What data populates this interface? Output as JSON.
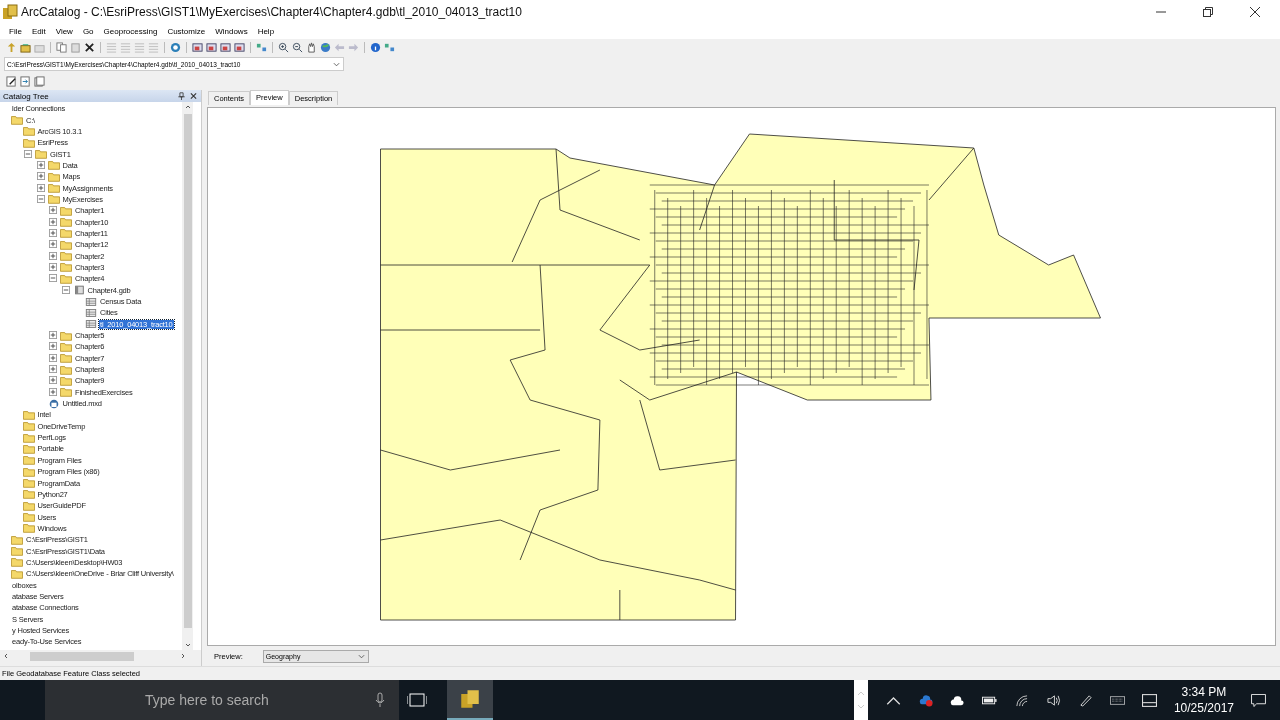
{
  "window": {
    "title": "ArcCatalog - C:\\EsriPress\\GIST1\\MyExercises\\Chapter4\\Chapter4.gdb\\tl_2010_04013_tract10"
  },
  "menu": [
    "File",
    "Edit",
    "View",
    "Go",
    "Geoprocessing",
    "Customize",
    "Windows",
    "Help"
  ],
  "location": {
    "value": "C:\\EsriPress\\GIST1\\MyExercises\\Chapter4\\Chapter4.gdb\\tl_2010_04013_tract10"
  },
  "catalog_tree": {
    "title": "Catalog Tree",
    "items": [
      {
        "label": "lder Connections",
        "selected": false,
        "children": [
          {
            "label": "C:\\",
            "kind": "folder",
            "selected": false,
            "children": [
              {
                "label": "ArcGIS 10.3.1",
                "kind": "folder",
                "selected": false
              },
              {
                "label": "EsriPress",
                "kind": "folder",
                "selected": false,
                "children": [
                  {
                    "label": "GIST1",
                    "kind": "folder",
                    "expanded": true,
                    "selected": false,
                    "children": [
                      {
                        "label": "Data",
                        "kind": "folder",
                        "expanded": false,
                        "selected": false
                      },
                      {
                        "label": "Maps",
                        "kind": "folder",
                        "expanded": false,
                        "selected": false
                      },
                      {
                        "label": "MyAssignments",
                        "kind": "folder",
                        "expanded": false,
                        "selected": false
                      },
                      {
                        "label": "MyExercises",
                        "kind": "folder",
                        "expanded": true,
                        "selected": false,
                        "children": [
                          {
                            "label": "Chapter1",
                            "kind": "folder",
                            "expanded": false,
                            "selected": false
                          },
                          {
                            "label": "Chapter10",
                            "kind": "folder",
                            "expanded": false,
                            "selected": false
                          },
                          {
                            "label": "Chapter11",
                            "kind": "folder",
                            "expanded": false,
                            "selected": false
                          },
                          {
                            "label": "Chapter12",
                            "kind": "folder",
                            "expanded": false,
                            "selected": false
                          },
                          {
                            "label": "Chapter2",
                            "kind": "folder",
                            "expanded": false,
                            "selected": false
                          },
                          {
                            "label": "Chapter3",
                            "kind": "folder",
                            "expanded": false,
                            "selected": false
                          },
                          {
                            "label": "Chapter4",
                            "kind": "folder",
                            "expanded": true,
                            "selected": false,
                            "children": [
                              {
                                "label": "Chapter4.gdb",
                                "kind": "gdb",
                                "expanded": true,
                                "selected": false,
                                "children": [
                                  {
                                    "label": "Census Data",
                                    "kind": "table",
                                    "selected": false
                                  },
                                  {
                                    "label": "Cities",
                                    "kind": "table",
                                    "selected": false
                                  },
                                  {
                                    "label": "tl_2010_04013_tract10",
                                    "kind": "table",
                                    "selected": true
                                  }
                                ]
                              }
                            ]
                          },
                          {
                            "label": "Chapter5",
                            "kind": "folder",
                            "expanded": false,
                            "selected": false
                          },
                          {
                            "label": "Chapter6",
                            "kind": "folder",
                            "expanded": false,
                            "selected": false
                          },
                          {
                            "label": "Chapter7",
                            "kind": "folder",
                            "expanded": false,
                            "selected": false
                          },
                          {
                            "label": "Chapter8",
                            "kind": "folder",
                            "expanded": false,
                            "selected": false
                          },
                          {
                            "label": "Chapter9",
                            "kind": "folder",
                            "expanded": false,
                            "selected": false
                          },
                          {
                            "label": "FinishedExercises",
                            "kind": "folder",
                            "expanded": false,
                            "selected": false
                          }
                        ]
                      },
                      {
                        "label": "Untitled.mxd",
                        "kind": "mxd",
                        "selected": false
                      }
                    ]
                  }
                ]
              },
              {
                "label": "Intel",
                "kind": "folder",
                "selected": false
              },
              {
                "label": "OneDriveTemp",
                "kind": "folder",
                "selected": false
              },
              {
                "label": "PerfLogs",
                "kind": "folder",
                "selected": false
              },
              {
                "label": "Portable",
                "kind": "folder",
                "selected": false
              },
              {
                "label": "Program Files",
                "kind": "folder",
                "selected": false
              },
              {
                "label": "Program Files (x86)",
                "kind": "folder",
                "selected": false
              },
              {
                "label": "ProgramData",
                "kind": "folder",
                "selected": false
              },
              {
                "label": "Python27",
                "kind": "folder",
                "selected": false
              },
              {
                "label": "UserGuidePDF",
                "kind": "folder",
                "selected": false
              },
              {
                "label": "Users",
                "kind": "folder",
                "selected": false
              },
              {
                "label": "Windows",
                "kind": "folder",
                "selected": false
              }
            ]
          },
          {
            "label": "C:\\EsriPress\\GIST1",
            "kind": "folder",
            "selected": false
          },
          {
            "label": "C:\\EsriPress\\GIST1\\Data",
            "kind": "folder",
            "selected": false
          },
          {
            "label": "C:\\Users\\kleen\\Desktop\\HW03",
            "kind": "folder",
            "selected": false
          },
          {
            "label": "C:\\Users\\kleen\\OneDrive - Briar Cliff University\\",
            "kind": "folder",
            "selected": false
          }
        ]
      },
      {
        "label": "olboxes",
        "selected": false
      },
      {
        "label": "atabase Servers",
        "selected": false
      },
      {
        "label": "atabase Connections",
        "selected": false
      },
      {
        "label": "S Servers",
        "selected": false
      },
      {
        "label": "y Hosted Services",
        "selected": false
      },
      {
        "label": "eady-To-Use Services",
        "selected": false
      }
    ]
  },
  "tabs": [
    {
      "label": "Contents",
      "selected": false
    },
    {
      "label": "Preview",
      "selected": true
    },
    {
      "label": "Description",
      "selected": false
    }
  ],
  "preview": {
    "label": "Preview:",
    "value": "Geography"
  },
  "status_bar": "File Geodatabase Feature Class selected",
  "taskbar": {
    "search": {
      "placeholder": "Type here to search"
    },
    "time": "3:34 PM",
    "date": "10/25/2017"
  }
}
